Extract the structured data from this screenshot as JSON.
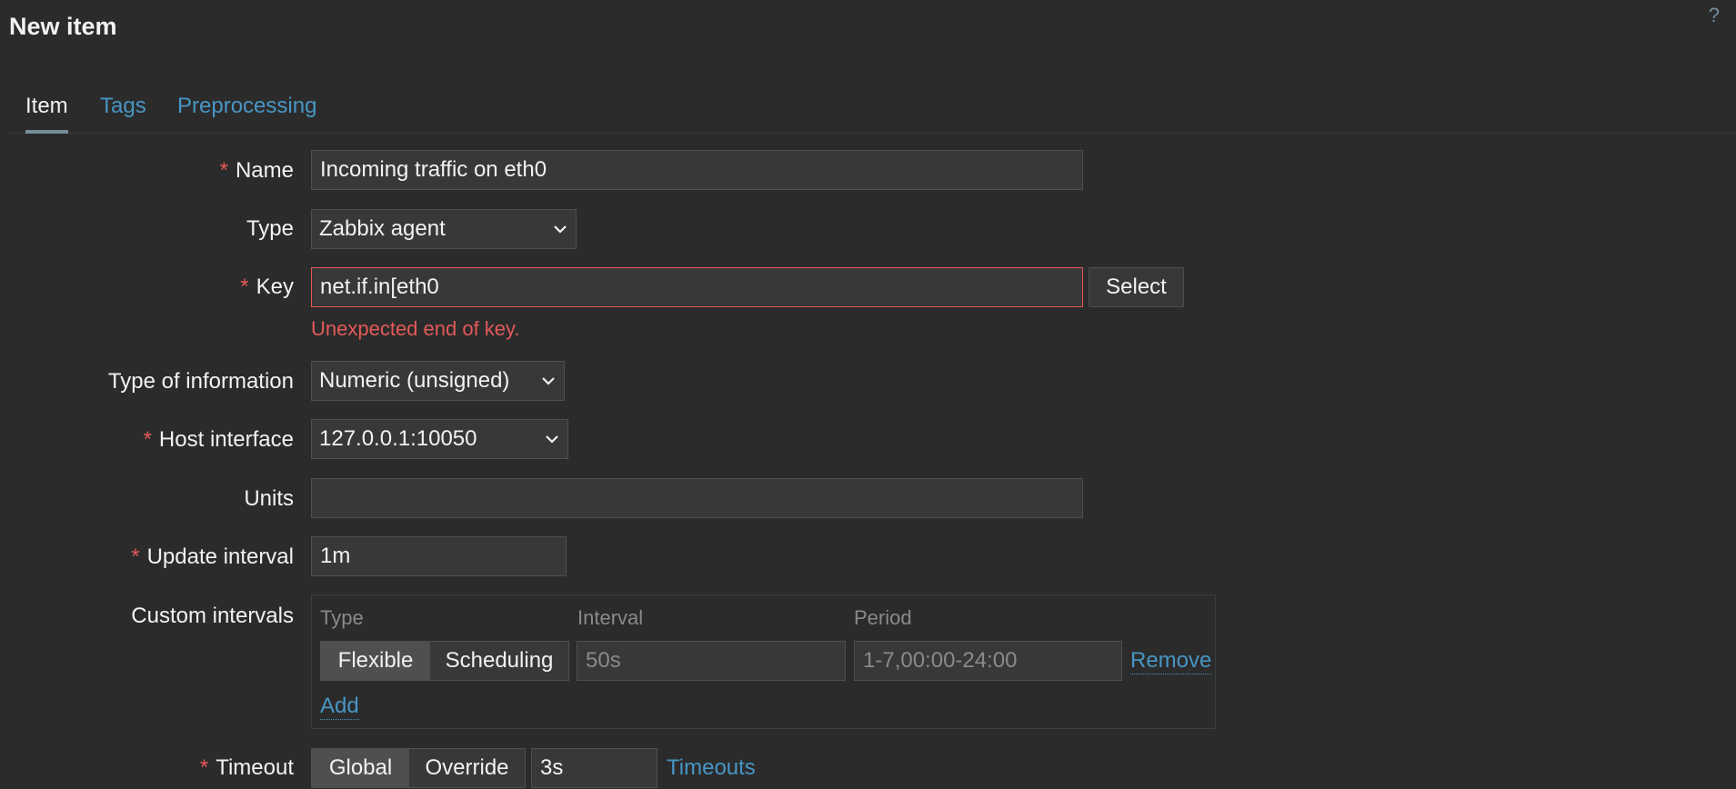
{
  "header": {
    "title": "New item",
    "help": "?"
  },
  "tabs": [
    {
      "label": "Item",
      "active": true
    },
    {
      "label": "Tags",
      "active": false
    },
    {
      "label": "Preprocessing",
      "active": false
    }
  ],
  "form": {
    "name": {
      "label": "Name",
      "required": "*",
      "value": "Incoming traffic on eth0"
    },
    "type": {
      "label": "Type",
      "value": "Zabbix agent"
    },
    "key": {
      "label": "Key",
      "required": "*",
      "value": "net.if.in[eth0",
      "select_label": "Select",
      "error": "Unexpected end of key."
    },
    "type_of_information": {
      "label": "Type of information",
      "value": "Numeric (unsigned)"
    },
    "host_interface": {
      "label": "Host interface",
      "required": "*",
      "value": "127.0.0.1:10050"
    },
    "units": {
      "label": "Units",
      "value": ""
    },
    "update_interval": {
      "label": "Update interval",
      "required": "*",
      "value": "1m"
    },
    "custom_intervals": {
      "label": "Custom intervals",
      "headers": {
        "type": "Type",
        "interval": "Interval",
        "period": "Period"
      },
      "row": {
        "flexible": "Flexible",
        "scheduling": "Scheduling",
        "interval_placeholder": "50s",
        "period_placeholder": "1-7,00:00-24:00",
        "remove": "Remove"
      },
      "add": "Add"
    },
    "timeout": {
      "label": "Timeout",
      "required": "*",
      "global": "Global",
      "override": "Override",
      "value": "3s",
      "link": "Timeouts"
    }
  },
  "colors": {
    "accent_link": "#4796c4",
    "error": "#e45959",
    "background": "#2b2b2b"
  }
}
